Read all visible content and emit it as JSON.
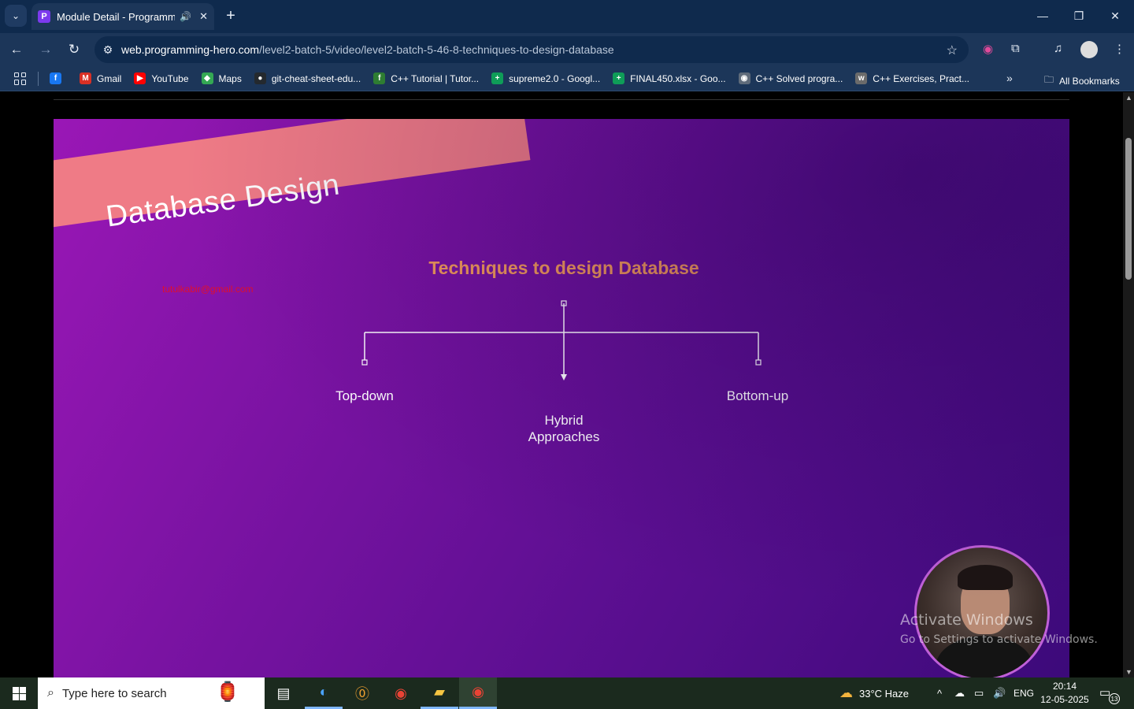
{
  "browser": {
    "tab": {
      "title": "Module Detail - Programming Hero",
      "favicon": "P"
    },
    "url_domain": "web.programming-hero.com",
    "url_path": "/level2-batch-5/video/level2-batch-5-46-8-techniques-to-design-database",
    "bookmarks": [
      {
        "label": "",
        "icon": "facebook-icon",
        "color": "#1877f2",
        "glyph": "f"
      },
      {
        "label": "Gmail",
        "icon": "gmail-icon",
        "color": "#d93025",
        "glyph": "M"
      },
      {
        "label": "YouTube",
        "icon": "youtube-icon",
        "color": "#ff0000",
        "glyph": "▶"
      },
      {
        "label": "Maps",
        "icon": "maps-icon",
        "color": "#34a853",
        "glyph": "◆"
      },
      {
        "label": "git-cheat-sheet-edu...",
        "icon": "github-icon",
        "color": "#24292e",
        "glyph": "●"
      },
      {
        "label": "C++ Tutorial | Tutor...",
        "icon": "tutorial-icon",
        "color": "#2e7d32",
        "glyph": "f"
      },
      {
        "label": "supreme2.0 - Googl...",
        "icon": "sheets-icon",
        "color": "#0f9d58",
        "glyph": "+"
      },
      {
        "label": "FINAL450.xlsx - Goo...",
        "icon": "sheets-icon",
        "color": "#0f9d58",
        "glyph": "+"
      },
      {
        "label": "C++ Solved progra...",
        "icon": "globe-icon",
        "color": "#5f6b7a",
        "glyph": "◉"
      },
      {
        "label": "C++ Exercises, Pract...",
        "icon": "w3r-icon",
        "color": "#6b6b6b",
        "glyph": "w"
      }
    ],
    "all_bookmarks_label": "All Bookmarks"
  },
  "slide": {
    "banner": "Database Design",
    "title": "Techniques to design Database",
    "email_watermark": "tutulkabir@gmail.com",
    "labels": {
      "left": "Top-down",
      "middle_1": "Hybrid",
      "middle_2": "Approaches",
      "right": "Bottom-up"
    }
  },
  "os_watermark": {
    "line1": "Activate Windows",
    "line2": "Go to Settings to activate Windows."
  },
  "taskbar": {
    "search_placeholder": "Type here to search",
    "weather": "33°C  Haze",
    "language": "ENG",
    "time": "20:14",
    "date": "12-05-2025",
    "notifications": "13"
  }
}
